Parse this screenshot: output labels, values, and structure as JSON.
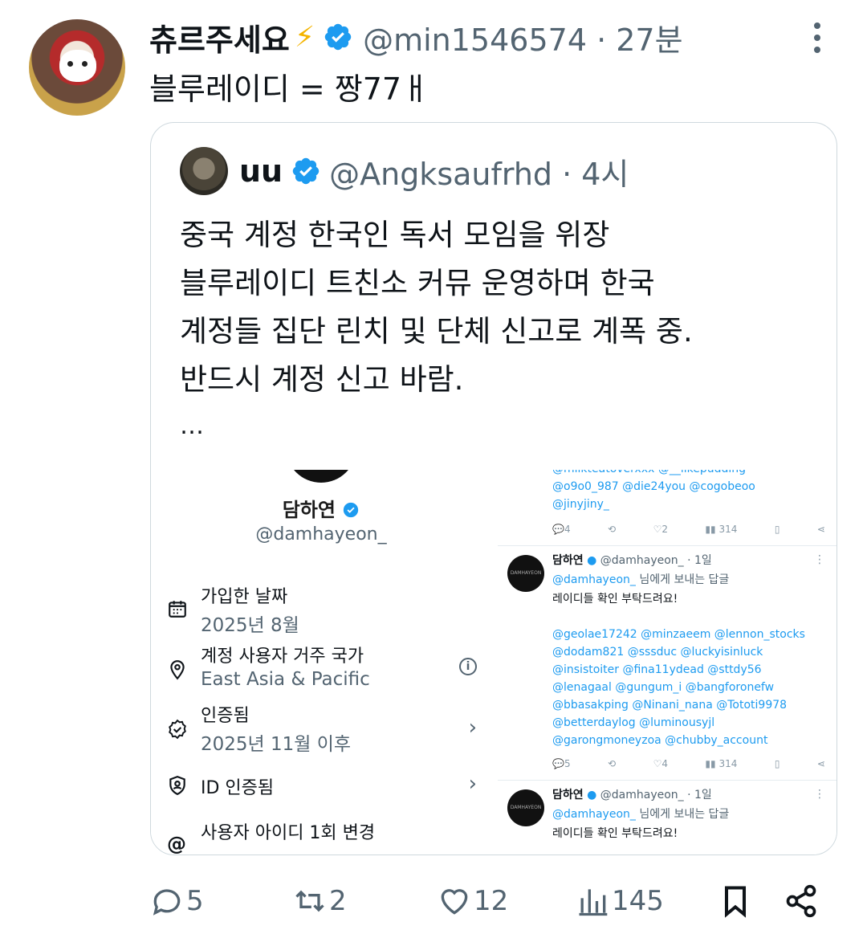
{
  "author": {
    "display_name": "츄르주세요",
    "emoji": "⚡",
    "handle": "@min1546574",
    "time": "27분",
    "handle_time": "@min1546574 · 27분"
  },
  "tweet_text": "블루레이디 = 짱77ㅐ",
  "quote": {
    "name": "uu",
    "handle_time": "@Angksaufrhd · 4시",
    "lines": [
      "중국 계정 한국인 독서 모임을 위장",
      "블루레이디 트친소 커뮤 운영하며 한국",
      "계정들 집단 린치 및 단체 신고로 계폭 중.",
      "반드시 계정 신고 바람."
    ],
    "ellipsis": "…",
    "profile": {
      "name": "담하연",
      "handle": "@damhayeon_",
      "rows": [
        {
          "label": "가입한 날짜",
          "value": "2025년 8월"
        },
        {
          "label": "계정 사용자 거주 국가",
          "value": "East Asia & Pacific"
        },
        {
          "label": "인증됨",
          "value": "2025년 11월 이후"
        },
        {
          "label": "ID 인증됨",
          "value": ""
        },
        {
          "label": "사용자 아이디 1회 변경",
          "value": ""
        }
      ]
    },
    "replies": {
      "top_mentions": [
        "@milkteatoverxxx @__likepudding",
        "@o9o0_987 @die24you @cogobeoo",
        "@jinyjiny_"
      ],
      "top_actions": {
        "reply": "4",
        "retweet": "",
        "like": "2",
        "views": "314"
      },
      "reply1": {
        "avatar_text": "DAMHAYEON",
        "name": "담하연",
        "handle_time": "@damhayeon_ · 1일",
        "reply_to": "@damhayeon_",
        "reply_suffix": " 님에게 보내는 답글",
        "text": "레이디들 확인 부탁드려요!",
        "mentions": [
          "@geolae17242 @minzaeem @lennon_stocks",
          "@dodam821 @sssduc @luckyisinluck",
          "@insistoiter @fina11ydead @sttdy56",
          "@lenagaal @gungum_i @bangforonefw",
          "@bbasakping @Ninani_nana @Tototi9978",
          "@betterdaylog @luminousyjl",
          "@garongmoneyzoa @chubby_account"
        ],
        "actions": {
          "reply": "5",
          "retweet": "",
          "like": "4",
          "views": "314"
        }
      },
      "reply2": {
        "avatar_text": "DAMHAYEON",
        "name": "담하연",
        "handle_time": "@damhayeon_ · 1일",
        "reply_to": "@damhayeon_",
        "reply_suffix": " 님에게 보내는 답글",
        "text": "레이디들 확인 부탁드려요!"
      }
    }
  },
  "actions": {
    "replies": "5",
    "retweets": "2",
    "likes": "12",
    "views": "145"
  },
  "colors": {
    "accent": "#1d9bf0",
    "muted": "#536471",
    "border": "#cfd9de",
    "text": "#0f1419"
  }
}
